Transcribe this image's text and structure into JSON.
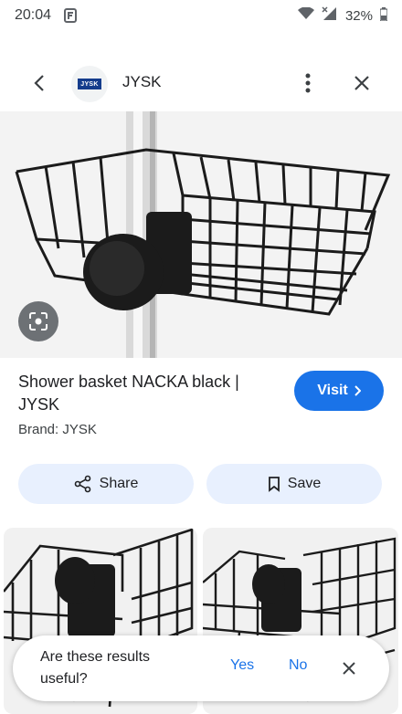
{
  "status_bar": {
    "time": "20:04",
    "battery": "32%",
    "app_icon": "f-icon"
  },
  "top_bar": {
    "site_name": "JYSK",
    "logo_text": "JYSK"
  },
  "product": {
    "title": "Shower basket NACKA black | JYSK",
    "brand": "Brand: JYSK",
    "visit_label": "Visit"
  },
  "actions": {
    "share_label": "Share",
    "save_label": "Save"
  },
  "feedback": {
    "question": "Are these results useful?",
    "yes_label": "Yes",
    "no_label": "No"
  }
}
